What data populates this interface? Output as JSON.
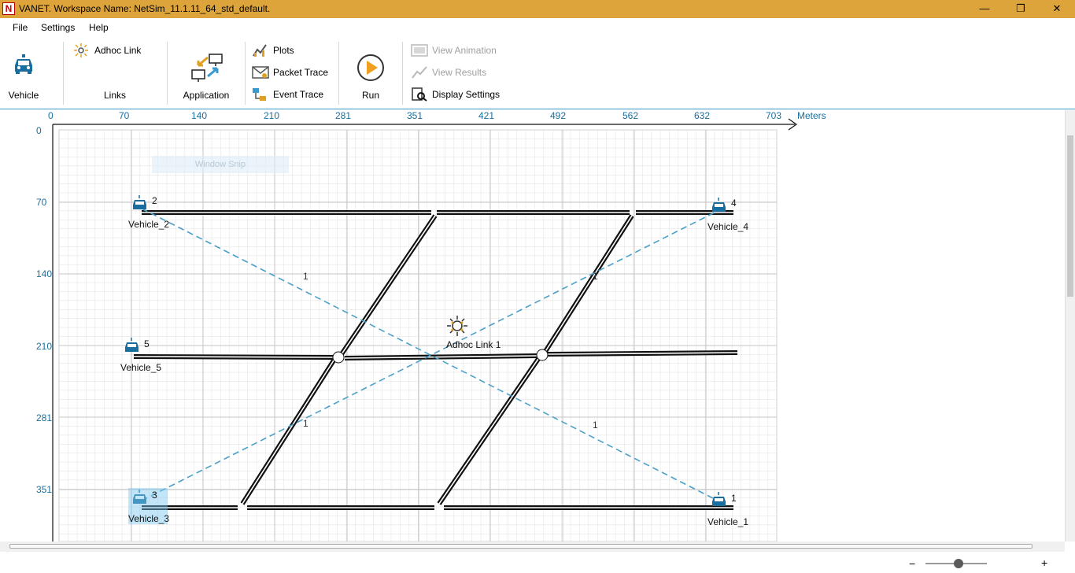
{
  "window": {
    "title": "VANET. Workspace Name: NetSim_11.1.11_64_std_default.",
    "logo": "N",
    "minimize_icon": "—",
    "restore_icon": "❐",
    "close_icon": "✕"
  },
  "menu": [
    "File",
    "Settings",
    "Help"
  ],
  "ribbon": {
    "vehicle_group": "Vehicle",
    "links_group": "Links",
    "adhoc_link": "Adhoc Link",
    "application": "Application",
    "plots": "Plots",
    "packet_trace": "Packet Trace",
    "event_trace": "Event Trace",
    "run": "Run",
    "view_animation": "View Animation",
    "view_results": "View Results",
    "display_settings": "Display Settings"
  },
  "axes": {
    "x_ticks": [
      "0",
      "70",
      "140",
      "210",
      "281",
      "351",
      "421",
      "492",
      "562",
      "632",
      "703"
    ],
    "x_unit": "Meters",
    "y_ticks": [
      "0",
      "70",
      "140",
      "210",
      "281",
      "351"
    ]
  },
  "overlay": {
    "snip_text": "Window Snip"
  },
  "vehicles": [
    {
      "id": "2",
      "name": "Vehicle_2"
    },
    {
      "id": "4",
      "name": "Vehicle_4"
    },
    {
      "id": "5",
      "name": "Vehicle_5"
    },
    {
      "id": "3",
      "name": "Vehicle_3"
    },
    {
      "id": "1",
      "name": "Vehicle_1"
    }
  ],
  "adhoc_link": {
    "name": "Adhoc Link 1",
    "wire_label": "1"
  },
  "zoom": {
    "minus": "−",
    "plus": "+",
    "level_fraction": 0.5
  },
  "colors": {
    "title_bar": "#dca43a",
    "accent": "#1a6e9f",
    "link": "#4aa0c8"
  }
}
